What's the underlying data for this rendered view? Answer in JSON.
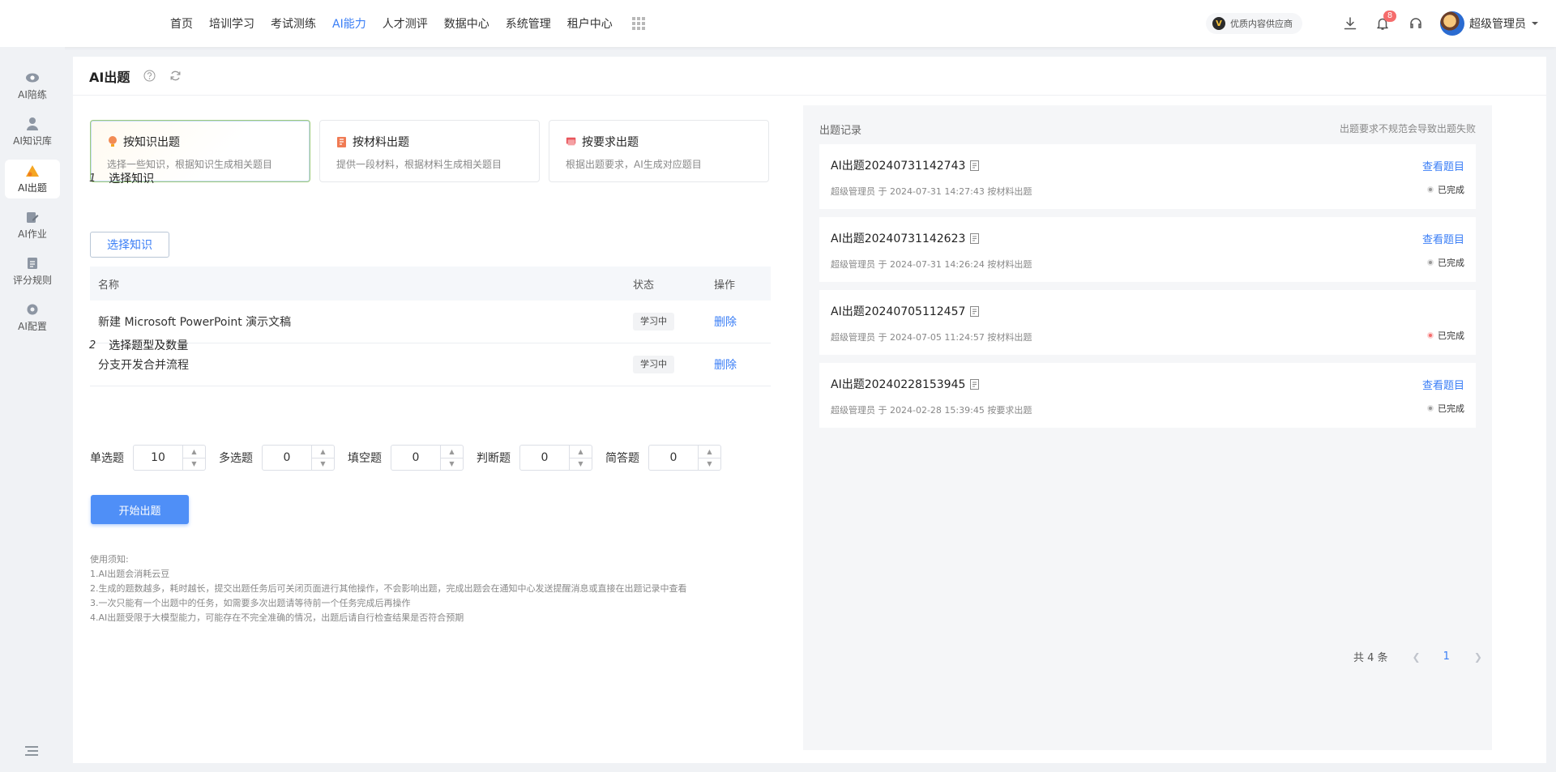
{
  "topnav": {
    "items": [
      "首页",
      "培训学习",
      "考试测练",
      "AI能力",
      "人才测评",
      "数据中心",
      "系统管理",
      "租户中心"
    ],
    "active_index": 3,
    "vendor_badge": "优质内容供应商",
    "notification_count": "8",
    "user_name": "超级管理员"
  },
  "sidebar": {
    "items": [
      {
        "label": "AI陪练",
        "icon": "eye-icon"
      },
      {
        "label": "AI知识库",
        "icon": "person-icon"
      },
      {
        "label": "AI出题",
        "icon": "question-icon"
      },
      {
        "label": "AI作业",
        "icon": "edit-icon"
      },
      {
        "label": "评分规则",
        "icon": "rule-icon"
      },
      {
        "label": "AI配置",
        "icon": "gear-icon"
      }
    ],
    "active_index": 2
  },
  "page": {
    "title": "AI出题"
  },
  "modes": [
    {
      "title": "按知识出题",
      "desc": "选择一些知识，根据知识生成相关题目",
      "icon": "bulb-icon"
    },
    {
      "title": "按材料出题",
      "desc": "提供一段材料，根据材料生成相关题目",
      "icon": "book-icon"
    },
    {
      "title": "按要求出题",
      "desc": "根据出题要求，AI生成对应题目",
      "icon": "flag-icon"
    }
  ],
  "step1": {
    "num": "1",
    "label": "选择知识",
    "button": "选择知识"
  },
  "table": {
    "headers": {
      "name": "名称",
      "status": "状态",
      "op": "操作"
    },
    "rows": [
      {
        "name": "新建 Microsoft PowerPoint 演示文稿",
        "status": "学习中",
        "op": "删除"
      },
      {
        "name": "分支开发合并流程",
        "status": "学习中",
        "op": "删除"
      }
    ]
  },
  "step2": {
    "num": "2",
    "label": "选择题型及数量"
  },
  "counts": [
    {
      "label": "单选题",
      "value": "10"
    },
    {
      "label": "多选题",
      "value": "0"
    },
    {
      "label": "填空题",
      "value": "0"
    },
    {
      "label": "判断题",
      "value": "0"
    },
    {
      "label": "简答题",
      "value": "0"
    }
  ],
  "start_button": "开始出题",
  "notes": [
    "使用须知:",
    "1.AI出题会消耗云豆",
    "2.生成的题数越多，耗时越长，提交出题任务后可关闭页面进行其他操作，不会影响出题，完成出题会在通知中心发送提醒消息或直接在出题记录中查看",
    "3.一次只能有一个出题中的任务，如需要多次出题请等待前一个任务完成后再操作",
    "4.AI出题受限于大模型能力，可能存在不完全准确的情况，出题后请自行检查结果是否符合预期"
  ],
  "records": {
    "title": "出题记录",
    "warning": "出题要求不规范会导致出题失败",
    "items": [
      {
        "name": "AI出题20240731142743",
        "meta": "超级管理员 于 2024-07-31 14:27:43 按材料出题",
        "view": "查看题目",
        "status": "已完成",
        "dot_color": "#999999"
      },
      {
        "name": "AI出题20240731142623",
        "meta": "超级管理员 于 2024-07-31 14:26:24 按材料出题",
        "view": "查看题目",
        "status": "已完成",
        "dot_color": "#999999"
      },
      {
        "name": "AI出题20240705112457",
        "meta": "超级管理员 于 2024-07-05 11:24:57 按材料出题",
        "view": "",
        "status": "已完成",
        "dot_color": "#f56c6c"
      },
      {
        "name": "AI出题20240228153945",
        "meta": "超级管理员 于 2024-02-28 15:39:45 按要求出题",
        "view": "查看题目",
        "status": "已完成",
        "dot_color": "#999999"
      }
    ],
    "total": "共 4 条",
    "page": "1"
  },
  "colors": {
    "accent": "#3a7ef6",
    "danger": "#f56c6c"
  }
}
